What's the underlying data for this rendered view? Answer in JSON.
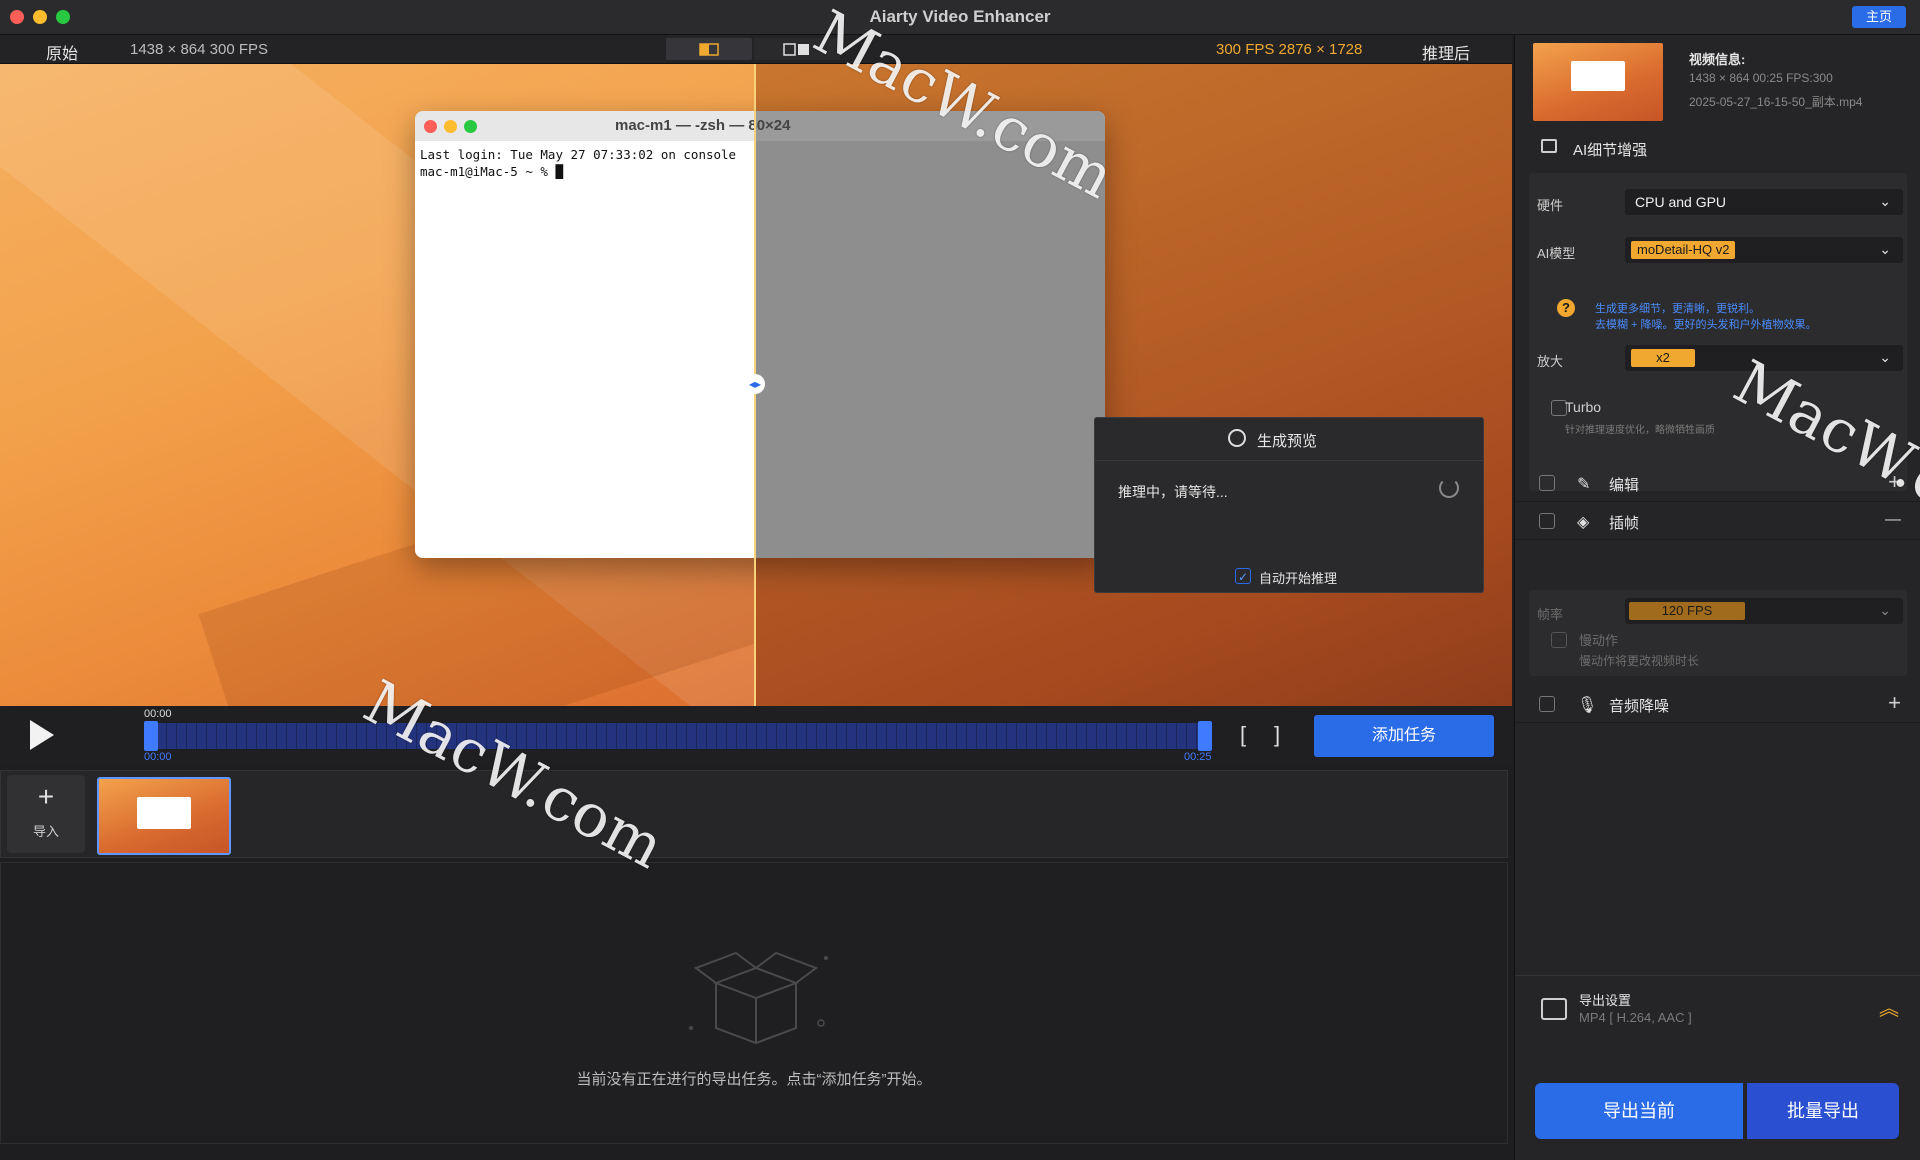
{
  "app": {
    "title": "Aiarty Video Enhancer",
    "home_label": "主页"
  },
  "infobar": {
    "original_label": "原始",
    "original_meta": "1438 ×  864   300 FPS",
    "after_meta": "300 FPS   2876 × 1728",
    "after_label": "推理后"
  },
  "terminal": {
    "title": "mac-m1 — -zsh — 80×24",
    "line1": "Last login: Tue May 27 07:33:02 on console",
    "line2": "mac-m1@iMac-5 ~ % █"
  },
  "popup": {
    "title": "生成预览",
    "message": "推理中，请等待...",
    "auto_label": "自动开始推理",
    "auto_checked": true
  },
  "timeline": {
    "time_current": "00:00",
    "time_start": "00:00",
    "time_end": "00:25",
    "bracket_open": "[",
    "bracket_close": "]",
    "add_task_label": "添加任务"
  },
  "thumbs": {
    "import_label": "导入",
    "import_plus": "+"
  },
  "tasks": {
    "empty_message": "当前没有正在进行的导出任务。点击“添加任务”开始。"
  },
  "video_info": {
    "title": "视频信息:",
    "line1": "1438 ×  864 00:25 FPS:300",
    "line2": "2025-05-27_16-15-50_副本.mp4"
  },
  "enhance": {
    "section_label": "AI细节增强",
    "hardware_label": "硬件",
    "hardware_value": "CPU and GPU",
    "model_label": "AI模型",
    "model_value": "moDetail-HQ  v2",
    "help_mark": "?",
    "help_line1": "生成更多细节，更清晰，更锐利。",
    "help_line2": "去模糊 + 降噪。更好的头发和户外植物效果。",
    "scale_label": "放大",
    "scale_value": "x2",
    "turbo_label": "Turbo",
    "turbo_sub": "针对推理速度优化，略微牺牲画质"
  },
  "features": {
    "edit_label": "编辑",
    "edit_sign": "+",
    "interp_label": "插帧",
    "interp_sign": "—",
    "fps_label": "帧率",
    "fps_value": "120 FPS",
    "slowmo_label": "慢动作",
    "slowmo_sub": "慢动作将更改视频时长",
    "denoise_label": "音频降噪",
    "denoise_sign": "+"
  },
  "export": {
    "settings_title": "导出设置",
    "settings_sub": "MP4 [ H.264, AAC ]",
    "export_current": "导出当前",
    "batch_export": "批量导出"
  },
  "watermark": {
    "text": "MacW.com"
  },
  "colors": {
    "accent": "#2a6be8",
    "orange": "#f0a830",
    "panel": "#252527"
  }
}
